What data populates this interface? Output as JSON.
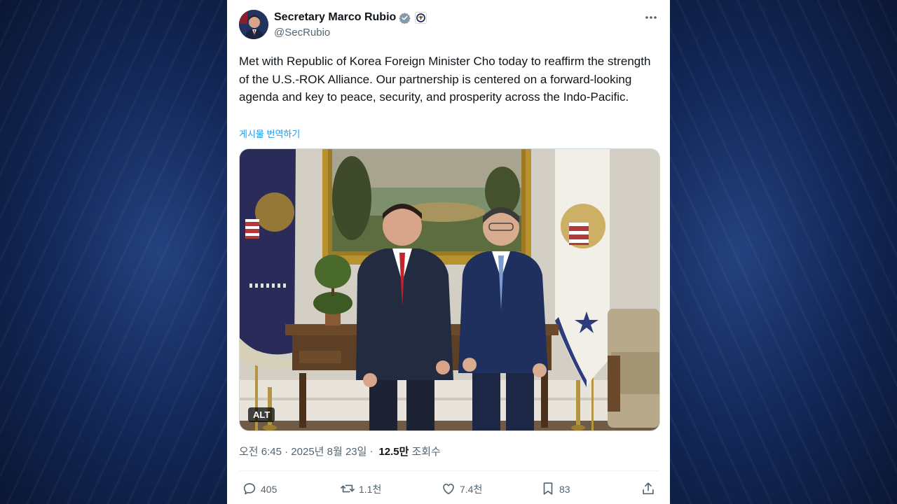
{
  "author": {
    "name": "Secretary Marco Rubio",
    "handle": "@SecRubio",
    "verified": true
  },
  "tweet": {
    "text": "Met with Republic of Korea Foreign Minister Cho today to reaffirm the strength of the U.S.-ROK Alliance. Our partnership is centered on a forward-looking agenda and key to peace, security, and prosperity across the Indo-Pacific.",
    "translate_label": "게시물 번역하기",
    "media_alt_label": "ALT"
  },
  "meta": {
    "timestamp": "오전 6:45 · 2025년 8월 23일",
    "separator": "·",
    "views_count": "12.5만",
    "views_label": "조회수"
  },
  "actions": {
    "replies": "405",
    "reposts": "1.1천",
    "likes": "7.4천",
    "bookmarks": "83"
  },
  "colors": {
    "accent": "#1d9bf0",
    "text_primary": "#0f1419",
    "text_secondary": "#536471",
    "background_frame": "#0c1a3e"
  },
  "icons": [
    "verified-badge-icon",
    "state-seal-icon",
    "more-icon",
    "reply-icon",
    "repost-icon",
    "like-icon",
    "bookmark-icon",
    "share-icon"
  ]
}
